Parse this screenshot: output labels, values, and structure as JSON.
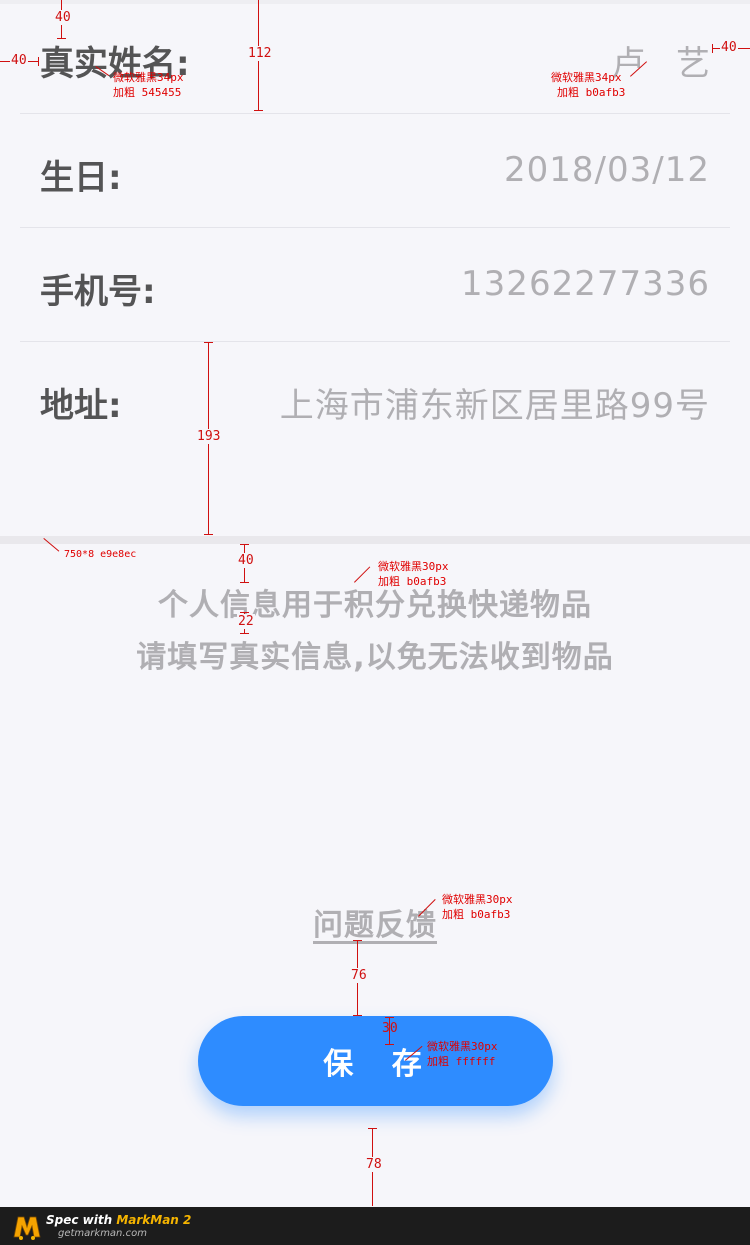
{
  "form": {
    "rows": [
      {
        "label": "真实姓名:",
        "value": "卢 艺"
      },
      {
        "label": "生日:",
        "value": "2018/03/12"
      },
      {
        "label": "手机号:",
        "value": "13262277336"
      },
      {
        "label": "地址:",
        "value": "上海市浦东新区居里路99号"
      }
    ]
  },
  "notice": {
    "line1": "个人信息用于积分兑换快递物品",
    "line2": "请填写真实信息,以免无法收到物品"
  },
  "feedback": {
    "label": "问题反馈"
  },
  "save_button": {
    "label": "保 存"
  },
  "annotations": {
    "label_font": "微软雅黑34px",
    "label_weight": "加粗 545455",
    "value_font": "微软雅黑34px",
    "value_weight": "加粗 b0afb3",
    "band_spec": "750*8 e9e8ec",
    "notice_font": "微软雅黑30px",
    "notice_weight": "加粗 b0afb3",
    "feedback_font": "微软雅黑30px",
    "feedback_weight": "加粗 b0afb3",
    "button_font": "微软雅黑30px",
    "button_weight": "加粗 ffffff",
    "dim_top": "40",
    "dim_left": "40",
    "dim_right": "40",
    "dim_row_height": "112",
    "dim_address_height": "193",
    "dim_notice_top": "40",
    "dim_line_gap": "22",
    "dim_feedback_gap": "76",
    "dim_button_text": "30",
    "dim_bottom": "78"
  },
  "footer": {
    "brand_prefix": "Spec with ",
    "brand_name": "MarkMan 2",
    "site": "getmarkman.com"
  },
  "colors": {
    "label": "#545455",
    "value": "#b0afb3",
    "band": "#e9e8ec",
    "button": "#2e8cff",
    "annotation": "#d01010"
  }
}
